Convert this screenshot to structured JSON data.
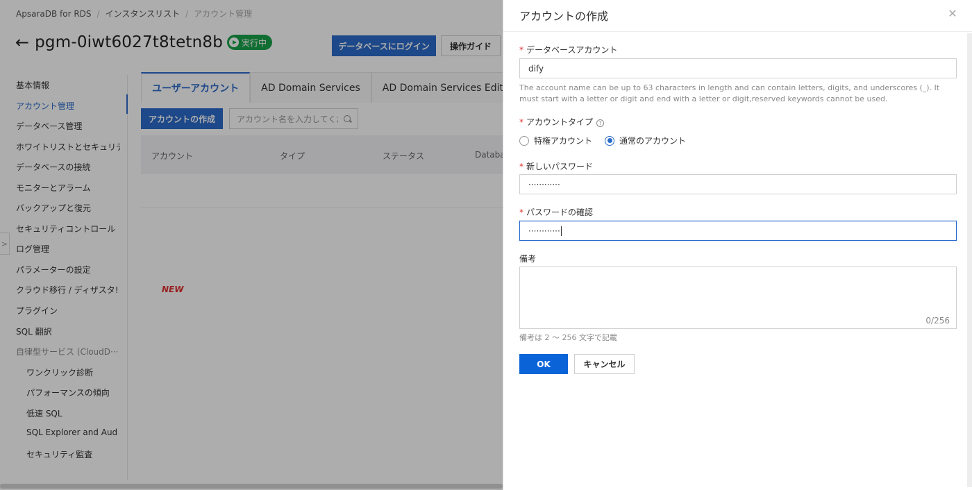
{
  "breadcrumb": {
    "items": [
      "ApsaraDB for RDS",
      "インスタンスリスト",
      "アカウント管理"
    ]
  },
  "instance": {
    "title": "pgm-0iwt6027t8tetn8b",
    "status": "実行中",
    "status_color": "#1aa34a"
  },
  "header_buttons": {
    "login": "データベースにログイン",
    "guide": "操作ガイド"
  },
  "sidebar": {
    "items": [
      {
        "label": "基本情報"
      },
      {
        "label": "アカウント管理"
      },
      {
        "label": "データベース管理"
      },
      {
        "label": "ホワイトリストとセキュリテ"
      },
      {
        "label": "データベースの接続"
      },
      {
        "label": "モニターとアラーム"
      },
      {
        "label": "バックアップと復元"
      },
      {
        "label": "セキュリティコントロール"
      },
      {
        "label": "ログ管理"
      },
      {
        "label": "パラメーターの設定"
      },
      {
        "label": "クラウド移行 / ディザスタ!"
      },
      {
        "label": "プラグイン"
      },
      {
        "label": "SQL 翻訳"
      },
      {
        "label": "自律型サービス (CloudD··· ^"
      },
      {
        "label": "ワンクリック診断"
      },
      {
        "label": "パフォーマンスの傾向"
      },
      {
        "label": "低速 SQL"
      },
      {
        "label": "SQL Explorer and Aud"
      },
      {
        "label": "セキュリティ監査"
      }
    ],
    "active": "アカウント管理"
  },
  "tabs": [
    "ユーザーアカウント",
    "AD Domain Services",
    "AD Domain Services Edit Histo"
  ],
  "toolbar": {
    "create_button": "アカウントの作成",
    "search_placeholder": "アカウント名を入力してくだ"
  },
  "table": {
    "columns": [
      "アカウント",
      "タイプ",
      "ステータス",
      "Databa"
    ]
  },
  "new_tag": "NEW",
  "drawer": {
    "title": "アカウントの作成",
    "close_icon": "close-icon",
    "db_account": {
      "label": "データベースアカウント",
      "value": "dify",
      "hint": "The account name can be up to 63 characters in length and can contain letters, digits, and underscores (_). It must start with a letter or digit and end with a letter or digit,reserved keywords cannot be used."
    },
    "account_type": {
      "label": "アカウントタイプ",
      "help": "?",
      "options": [
        "特権アカウント",
        "通常のアカウント"
      ],
      "selected": "通常のアカウント"
    },
    "new_password": {
      "label": "新しいパスワード",
      "value": "············"
    },
    "confirm_password": {
      "label": "パスワードの確認",
      "value": "············"
    },
    "remarks": {
      "label": "備考",
      "counter": "0/256",
      "hint": "備考は 2 ～ 256 文字で記載"
    },
    "ok": "OK",
    "cancel": "キャンセル"
  },
  "required_mark": "*",
  "colors": {
    "primary": "#2b6bcb",
    "ok_button": "#0a64d8",
    "required": "#e0302e"
  }
}
